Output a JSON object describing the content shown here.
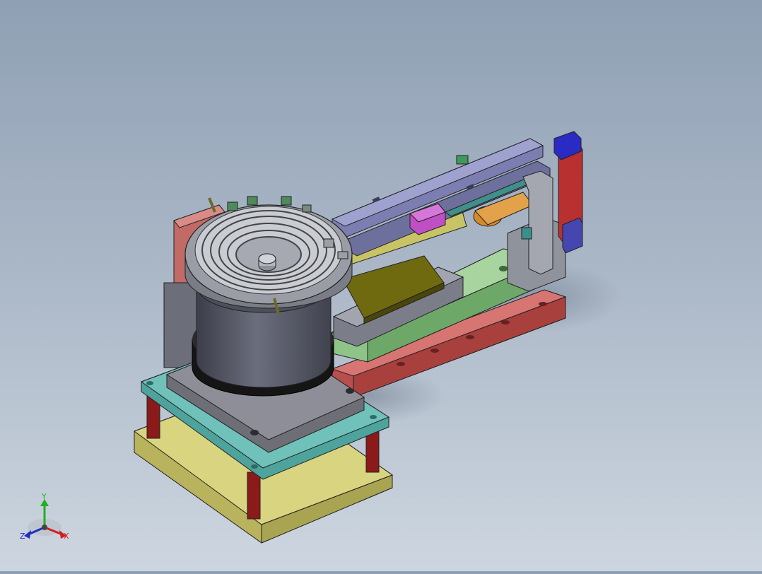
{
  "viewport": {
    "background_top": "#8fa0b4",
    "background_bottom": "#cdd6e0"
  },
  "model": {
    "parts": [
      {
        "name": "base-plate",
        "color": "#c8c26a"
      },
      {
        "name": "support-column",
        "color": "#8b1a1a"
      },
      {
        "name": "bowl-mount-plate",
        "color": "#5fb3ad"
      },
      {
        "name": "bowl-drive-base",
        "color": "#6e6e76"
      },
      {
        "name": "drive-ring",
        "color": "#1c1c1c"
      },
      {
        "name": "bowl-body",
        "color": "#5d5f6e"
      },
      {
        "name": "feeder-bowl",
        "color": "#8a8d96"
      },
      {
        "name": "side-bracket",
        "color": "#c26a66"
      },
      {
        "name": "linear-base-rail",
        "color": "#c56360"
      },
      {
        "name": "linear-frame",
        "color": "#7fb37a"
      },
      {
        "name": "chute-plate",
        "color": "#6e6a12"
      },
      {
        "name": "guide-rail",
        "color": "#8586b8"
      },
      {
        "name": "sensor-block",
        "color": "#c050c0"
      },
      {
        "name": "cylinder",
        "color": "#d98a2a"
      },
      {
        "name": "end-block-red",
        "color": "#c23a3a"
      },
      {
        "name": "end-block-blue",
        "color": "#2d2dc0"
      }
    ]
  },
  "triad": {
    "x_label": "X",
    "y_label": "Y",
    "z_label": "Z",
    "x_color": "#d02020",
    "y_color": "#20b020",
    "z_color": "#2030c0"
  }
}
